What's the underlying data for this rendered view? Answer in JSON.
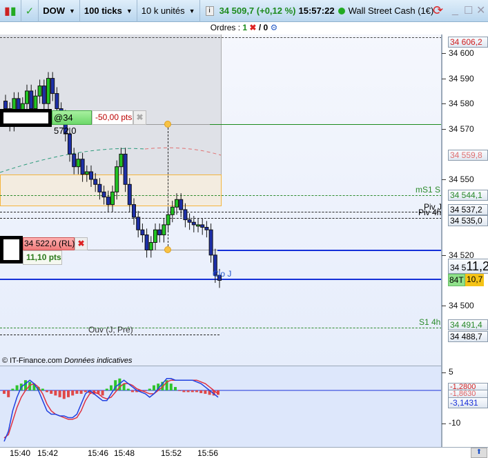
{
  "toolbar": {
    "symbol": "DOW",
    "period": "100 ticks",
    "quantity": "10 k unités",
    "price": "34 509,7 (+0,12 %)",
    "time": "15:57:22",
    "instrument": "Wall Street Cash (1€)"
  },
  "orders": {
    "label": "Ordres :",
    "open_count": "1",
    "sep": "/ 0"
  },
  "axis": {
    "ticks": [
      "34 600",
      "34 590",
      "34 580",
      "34 570",
      "34 550",
      "34 520",
      "34 500"
    ],
    "boxes": {
      "top": "34 606,2",
      "ma": "34 559,8",
      "ms1s": "34 544,1",
      "pivj": "34 537,2",
      "piv4h": "34 535,0",
      "last_small": "34 5",
      "last_big": "11,2",
      "ticks_badge": "84T",
      "countdown": "10,7",
      "s14h": "34 491,4",
      "ouv": "34 488,7"
    }
  },
  "levels": {
    "ms1s": "mS1 S",
    "pivj": "Piv J",
    "piv4h": "Piv 4h",
    "s14h": "S1 4h",
    "ouv": "Ouv (J; Pré)",
    "cloj": "Clo J"
  },
  "order_stop": {
    "price": "@34 572,0",
    "pts": "-50,00 pts"
  },
  "order_limit": {
    "price": "34 522,0 (RL)",
    "pts": "11,10 pts"
  },
  "footer": {
    "copyright": "© IT-Finance.com",
    "note": "Données indicatives"
  },
  "indicator": {
    "ticks": [
      "5",
      "-10"
    ],
    "values": {
      "v1": "-1,2800",
      "v2": "-1,8630",
      "v3": "-3,1431"
    }
  },
  "time_axis": [
    "15:40",
    "15:42",
    "15:46",
    "15:48",
    "15:52",
    "15:56"
  ],
  "colors": {
    "up": "#22c322",
    "down": "#1d2fa8",
    "positive": "#1a8a1a",
    "negative": "#c00000"
  },
  "candles_close": [
    34578,
    34572,
    34582,
    34576,
    34580,
    34585,
    34578,
    34583,
    34587,
    34580,
    34590,
    34584,
    34578,
    34575,
    34568,
    34560,
    34555,
    34558,
    34552,
    34553,
    34550,
    34548,
    34545,
    34543,
    34540,
    34545,
    34555,
    34560,
    34548,
    34540,
    34535,
    34530,
    34528,
    34522,
    34525,
    34530,
    34528,
    34532,
    34536,
    34539,
    34542,
    34538,
    34534,
    34533,
    34532,
    34532,
    34531,
    34530,
    34520,
    34512,
    34510
  ],
  "histogram": [
    -1,
    -2,
    0.5,
    1.5,
    2,
    3,
    2.5,
    2,
    1,
    0.5,
    -0.5,
    -1,
    -1.5,
    -2,
    -2.5,
    -2,
    -1.5,
    -1,
    -1,
    -0.5,
    -0.8,
    -1.2,
    -1,
    -1.5,
    0.5,
    1.5,
    3,
    3.5,
    2,
    0.5,
    -0.5,
    -0.5,
    -0.3,
    -0.2,
    0.5,
    1.5,
    2,
    2.5,
    3,
    2,
    1,
    -0.2,
    -0.5,
    -0.5,
    -0.5,
    -0.5,
    -0.8,
    -1,
    -1.3,
    -1.5,
    -1.3
  ],
  "macd": [
    -15,
    -12,
    -6,
    -2,
    1,
    2,
    3,
    2,
    0,
    -3,
    -6,
    -7,
    -7,
    -7.5,
    -7.5,
    -8,
    -8,
    -7,
    -4,
    -1,
    0,
    -1,
    -2,
    -3,
    -3,
    -1,
    1,
    2,
    3,
    2,
    1,
    0,
    -0.5,
    -1,
    -2,
    -1,
    0.5,
    2,
    3.5,
    3.5,
    3,
    3,
    3,
    3,
    3,
    2.5,
    2,
    1,
    0,
    -1,
    -2
  ],
  "signal": [
    -14,
    -13,
    -9,
    -5,
    -2,
    0,
    1.5,
    2,
    1,
    -1,
    -4,
    -6,
    -7,
    -7.5,
    -8,
    -8.5,
    -8.5,
    -8,
    -6,
    -3,
    -1,
    -0.5,
    -1,
    -2,
    -2.5,
    -2,
    -0.5,
    1,
    2,
    2,
    1.5,
    0.5,
    0,
    -0.5,
    -1,
    -1,
    0,
    1,
    2.5,
    3,
    3,
    3,
    3,
    3,
    3,
    3,
    2.5,
    2,
    1,
    0,
    -1
  ]
}
